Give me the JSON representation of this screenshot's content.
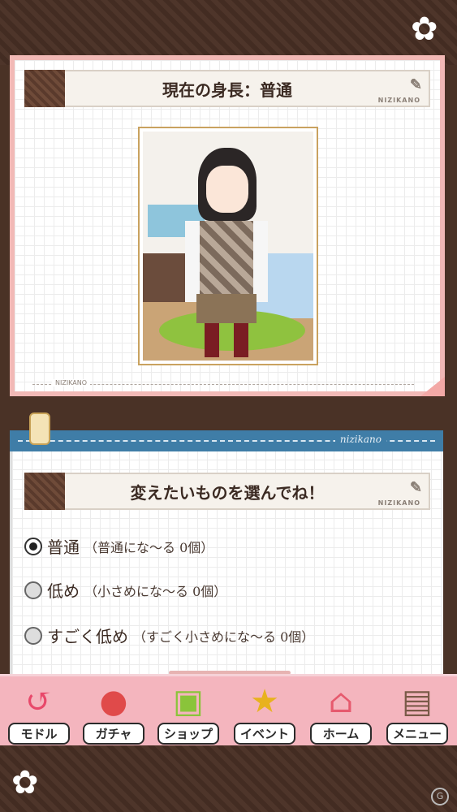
{
  "header": {
    "title": "現在の身長：普通",
    "tag": "NIZIKANO"
  },
  "photo": {
    "caption_line": "NIZIKANO"
  },
  "section": {
    "band_label": "nizikano",
    "title": "変えたいものを選んでね！",
    "tag": "NIZIKANO"
  },
  "options": [
    {
      "label": "普通",
      "detail": "（普通にな〜る 0個）",
      "selected": true
    },
    {
      "label": "低め",
      "detail": "（小さめにな〜る 0個）",
      "selected": false
    },
    {
      "label": "すごく低め",
      "detail": "（すごく小さめにな〜る 0個）",
      "selected": false
    }
  ],
  "nav": [
    {
      "label": "モドル",
      "icon": "back-icon"
    },
    {
      "label": "ガチャ",
      "icon": "gacha-icon"
    },
    {
      "label": "ショップ",
      "icon": "shop-basket-icon"
    },
    {
      "label": "イベント",
      "icon": "trophy-icon"
    },
    {
      "label": "ホーム",
      "icon": "home-icon"
    },
    {
      "label": "メニュー",
      "icon": "menu-cat-icon"
    }
  ],
  "colors": {
    "nav_bg": "#f4b5be",
    "band": "#3f7da7",
    "wood": "#4e352a"
  }
}
